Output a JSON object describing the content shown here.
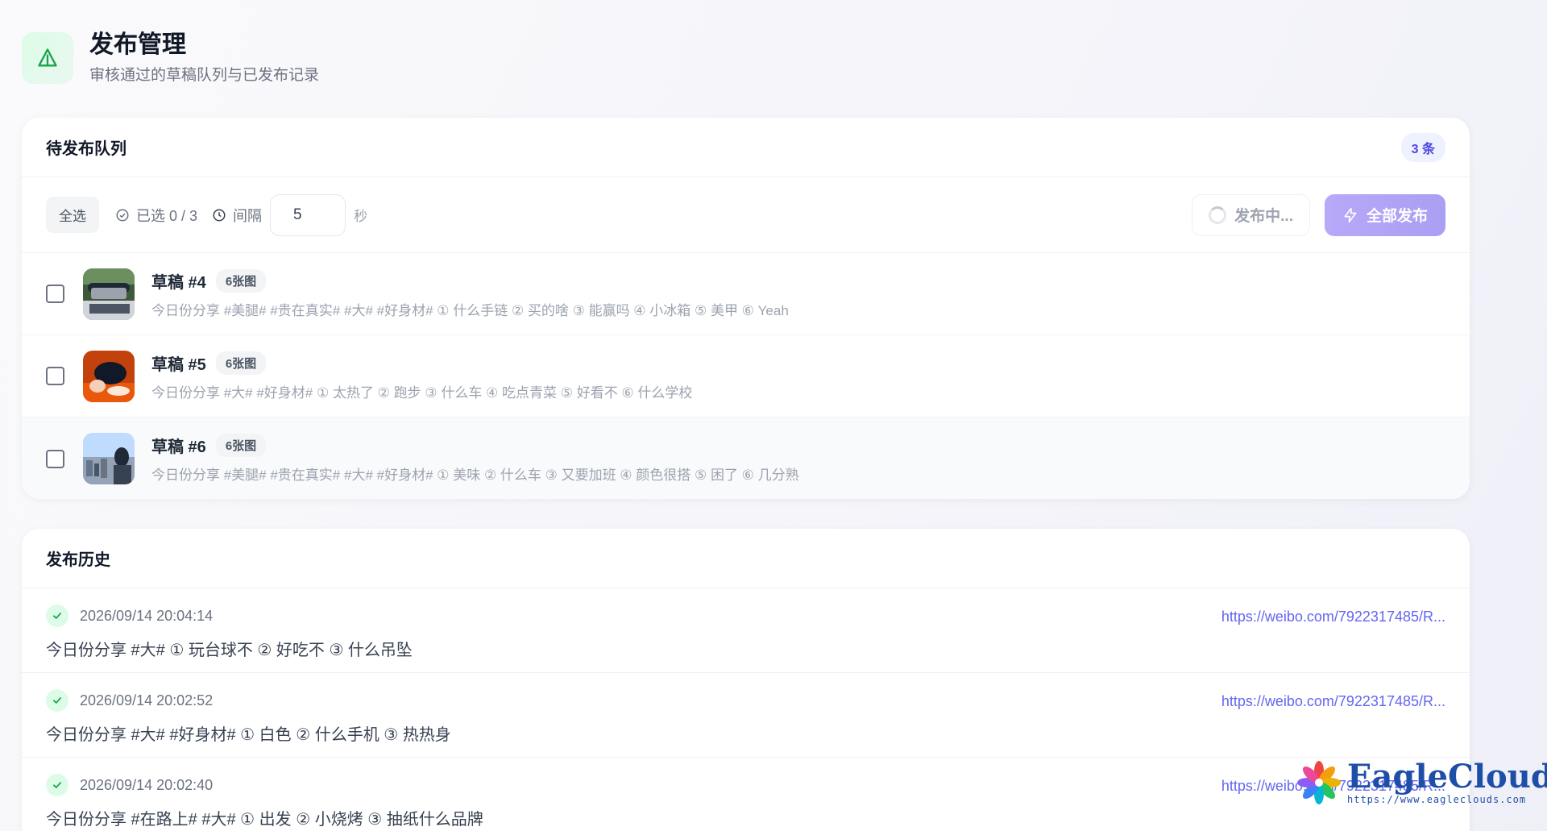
{
  "header": {
    "title": "发布管理",
    "subtitle": "审核通过的草稿队列与已发布记录",
    "icon": "send-triangle-icon",
    "icon_color": "#16a34a"
  },
  "queue": {
    "title": "待发布队列",
    "count_badge": "3 条",
    "toolbar": {
      "select_all_label": "全选",
      "selected_text": "已选 0 / 3",
      "interval_label": "间隔",
      "interval_value": "5",
      "interval_unit": "秒",
      "publishing_label": "发布中...",
      "publish_all_label": "全部发布"
    },
    "drafts": [
      {
        "title": "草稿 #4",
        "image_count": "6张图",
        "checked": false,
        "description": "今日份分享 #美腿# #贵在真实# #大# #好身材# ① 什么手链 ② 买的啥 ③ 能赢吗 ④ 小冰箱 ⑤ 美甲 ⑥ Yeah"
      },
      {
        "title": "草稿 #5",
        "image_count": "6张图",
        "checked": false,
        "description": "今日份分享 #大# #好身材# ① 太热了 ② 跑步 ③ 什么车 ④ 吃点青菜 ⑤ 好看不 ⑥ 什么学校"
      },
      {
        "title": "草稿 #6",
        "image_count": "6张图",
        "checked": false,
        "description": "今日份分享 #美腿# #贵在真实# #大# #好身材# ① 美味 ② 什么车 ③ 又要加班 ④ 颜色很搭 ⑤ 困了 ⑥ 几分熟"
      }
    ]
  },
  "history": {
    "title": "发布历史",
    "items": [
      {
        "time": "2026/09/14 20:04:14",
        "link": "https://weibo.com/7922317485/R...",
        "text": "今日份分享 #大# ① 玩台球不 ② 好吃不 ③ 什么吊坠"
      },
      {
        "time": "2026/09/14 20:02:52",
        "link": "https://weibo.com/7922317485/R...",
        "text": "今日份分享 #大# #好身材# ① 白色 ② 什么手机 ③ 热热身"
      },
      {
        "time": "2026/09/14 20:02:40",
        "link": "https://weibo.com/7922317485/R...",
        "text": "今日份分享 #在路上# #大# ① 出发 ② 小烧烤 ③ 抽纸什么品牌"
      }
    ]
  },
  "watermark": {
    "name": "EagleClouds",
    "url": "https://www.eagleclouds.com"
  },
  "colors": {
    "accent": "#6366f1",
    "publish_button": "#b4a6f6",
    "success": "#22c55e"
  }
}
